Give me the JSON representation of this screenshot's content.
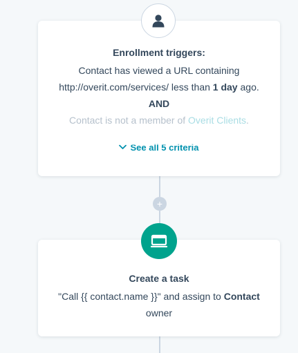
{
  "trigger": {
    "title": "Enrollment triggers:",
    "line1": "Contact has viewed a URL containing",
    "url": "http://overit.com/services/",
    "mid": "less than",
    "days": "1 day",
    "tail": "ago.",
    "and": "AND",
    "line3_pre": "Contact is not a member of",
    "line3_link": "Overit Clients",
    "line3_end": ".",
    "see_all": "See all 5 criteria",
    "icon": "user-icon"
  },
  "add_action": {
    "label": "+"
  },
  "task": {
    "title": "Create a task",
    "desc_quote": "\"Call {{ contact.name }}\"",
    "desc_mid": "and assign to",
    "desc_bold": "Contact",
    "desc_end": "owner",
    "icon": "task-icon",
    "color": "#00a38d"
  }
}
